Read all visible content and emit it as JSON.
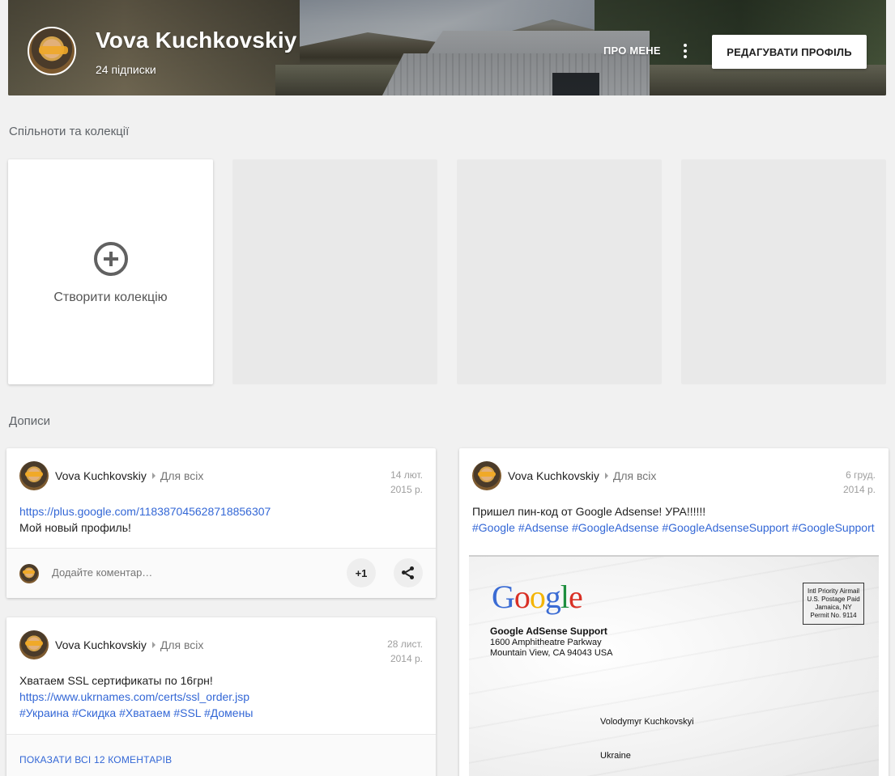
{
  "profile": {
    "name": "Vova Kuchkovskiy",
    "subtitle": "24 підписки",
    "about_label": "ПРО МЕНЕ",
    "edit_label": "РЕДАГУВАТИ ПРОФІЛЬ"
  },
  "sections": {
    "collections_title": "Спільноти та колекції",
    "posts_title": "Дописи"
  },
  "collections": {
    "create_label": "Створити колекцію"
  },
  "posts": [
    {
      "author": "Vova Kuchkovskiy",
      "audience": "Для всіх",
      "date_line1": "14 лют.",
      "date_line2": "2015 р.",
      "link": "https://plus.google.com/118387045628718856307",
      "text": "Мой новый профиль!",
      "comment_placeholder": "Додайте коментар…",
      "plus_one": "+1"
    },
    {
      "author": "Vova Kuchkovskiy",
      "audience": "Для всіх",
      "date_line1": "28 лист.",
      "date_line2": "2014 р.",
      "text": "Хватаем SSL сертификаты по 16грн!",
      "link": "https://www.ukrnames.com/certs/ssl_order.jsp",
      "hashtags": [
        "#Украина",
        "#Скидка",
        "#Хватаем",
        "#SSL",
        "#Домены"
      ],
      "show_comments": "ПОКАЗАТИ ВСІ 12 КОМЕНТАРІВ"
    },
    {
      "author": "Vova Kuchkovskiy",
      "audience": "Для всіх",
      "date_line1": "6 груд.",
      "date_line2": "2014 р.",
      "text": "Пришел пин-код от Google Adsense! УРА!!!!!!",
      "hashtags": [
        "#Google",
        "#Adsense",
        "#GoogleAdsense",
        "#GoogleAdsenseSupport",
        "#GoogleSupport"
      ],
      "envelope": {
        "sender_name": "Google AdSense Support",
        "sender_line1": "1600 Amphitheatre Parkway",
        "sender_line2": "Mountain View, CA 94043 USA",
        "stamp_line1": "Intl Priority Airmail",
        "stamp_line2": "U.S. Postage Paid",
        "stamp_line3": "Jamaica, NY",
        "stamp_line4": "Permit No. 9114",
        "recipient": "Volodymyr Kuchkovskyi",
        "country": "Ukraine"
      }
    }
  ]
}
